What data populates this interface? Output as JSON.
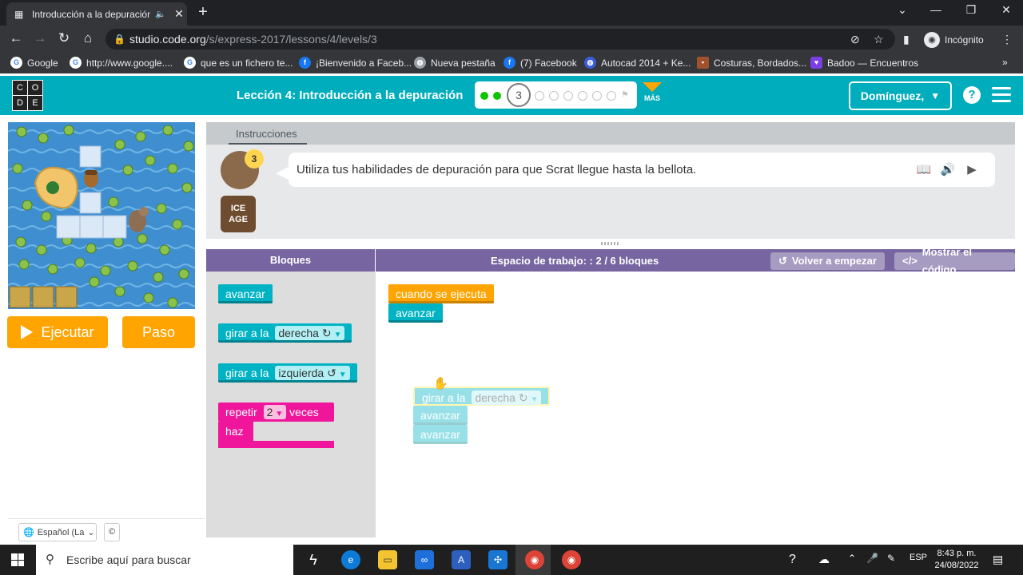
{
  "browser": {
    "tab_title": "Introducción a la depuración",
    "new_tab_label": "+",
    "window_controls": [
      "⌄",
      "—",
      "❐",
      "✕"
    ],
    "url_host": "studio.code.org",
    "url_path": "/s/express-2017/lessons/4/levels/3",
    "profile_label": "Incógnito",
    "bookmarks": [
      {
        "label": "Google",
        "icon": "google-icon",
        "color": "#4285f4"
      },
      {
        "label": "http://www.google....",
        "icon": "google-icon",
        "color": "#4285f4"
      },
      {
        "label": "que es un fichero te...",
        "icon": "google-icon",
        "color": "#4285f4"
      },
      {
        "label": "¡Bienvenido a Faceb...",
        "icon": "facebook-icon",
        "color": "#1877f2"
      },
      {
        "label": "Nueva pestaña",
        "icon": "globe-icon",
        "color": "#9aa0a6"
      },
      {
        "label": "(7) Facebook",
        "icon": "facebook-icon",
        "color": "#1877f2"
      },
      {
        "label": "Autocad 2014 + Ke...",
        "icon": "globe-icon",
        "color": "#3b5bdb"
      },
      {
        "label": "Costuras, Bordados...",
        "icon": "site-icon",
        "color": "#a0522d"
      },
      {
        "label": "Badoo — Encuentros",
        "icon": "heart-icon",
        "color": "#7b3fe4"
      }
    ]
  },
  "header": {
    "logo_letters": [
      "C",
      "O",
      "D",
      "E"
    ],
    "lesson_title": "Lección 4: Introducción a la depuración",
    "current_level": "3",
    "more_label": "MÁS",
    "user_label": "Domínguez,",
    "help_label": "?"
  },
  "controls": {
    "run_label": "Ejecutar",
    "step_label": "Paso"
  },
  "instructions": {
    "tab_label": "Instrucciones",
    "text": "Utiliza tus habilidades de depuración para que Scrat llegue hasta la bellota.",
    "hint_count": "3",
    "brand": "ICE AGE"
  },
  "workspace": {
    "blocks_header": "Bloques",
    "title": "Espacio de trabajo: : 2 / 6 bloques",
    "reset_label": "Volver a empezar",
    "show_code_label": "Mostrar el código"
  },
  "toolbox": {
    "move_forward": "avanzar",
    "turn_prefix": "girar a la",
    "right": "derecha ↻",
    "left": "izquierda ↺",
    "repeat_prefix": "repetir",
    "repeat_count": "2",
    "repeat_suffix": "veces",
    "do_label": "haz"
  },
  "program": {
    "when_run": "cuando se ejecuta",
    "move_forward": "avanzar",
    "ghost_turn_prefix": "girar a la",
    "ghost_turn_value": "derecha ↻",
    "ghost_move_1": "avanzar",
    "ghost_move_2": "avanzar"
  },
  "footer": {
    "language": "Español (La",
    "copyright": "©"
  },
  "taskbar": {
    "search_placeholder": "Escribe aquí para buscar",
    "language": "ESP",
    "time": "8:43 p. m.",
    "date": "24/08/2022"
  }
}
